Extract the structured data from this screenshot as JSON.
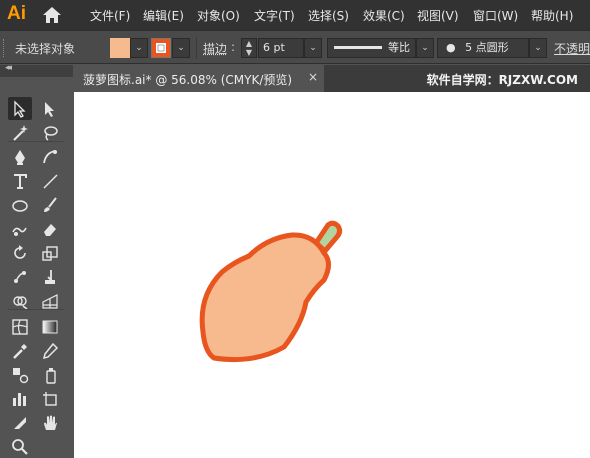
{
  "app": {
    "logo": "Ai"
  },
  "menu": [
    "文件(F)",
    "编辑(E)",
    "对象(O)",
    "文字(T)",
    "选择(S)",
    "效果(C)",
    "视图(V)",
    "窗口(W)",
    "帮助(H)"
  ],
  "control_bar": {
    "selection_status": "未选择对象",
    "fill_color": "#f7b98e",
    "stroke_color": "#e8551f",
    "stroke_label": "描边",
    "stroke_width": "6 pt",
    "profile_label": "等比",
    "brush_label": "5 点圆形",
    "opacity_label": "不透明"
  },
  "document": {
    "tab_title": "菠萝图标.ai* @ 56.08% (CMYK/预览)",
    "close": "×",
    "watermark": "软件自学网：RJZXW.COM"
  },
  "artwork": {
    "body_fill": "#f7b98e",
    "outline_color": "#e8551f",
    "stem_fill": "#b3d4a1"
  },
  "toolbox": {
    "collapse": "◂◂",
    "tools": [
      "selection-tool-icon",
      "direct-selection-tool-icon",
      "magic-wand-tool-icon",
      "lasso-tool-icon",
      "pen-tool-icon",
      "curvature-tool-icon",
      "type-tool-icon",
      "line-segment-tool-icon",
      "ellipse-tool-icon",
      "paintbrush-tool-icon",
      "shaper-tool-icon",
      "eraser-tool-icon",
      "rotate-tool-icon",
      "scale-tool-icon",
      "puppet-warp-tool-icon",
      "free-transform-tool-icon",
      "shape-builder-tool-icon",
      "perspective-grid-tool-icon",
      "mesh-tool-icon",
      "gradient-tool-icon",
      "eyedropper-tool-icon",
      "measure-tool-icon",
      "blend-tool-icon",
      "symbol-sprayer-tool-icon",
      "column-graph-tool-icon",
      "artboard-tool-icon",
      "slice-tool-icon",
      "hand-tool-icon",
      "zoom-tool-icon"
    ]
  }
}
